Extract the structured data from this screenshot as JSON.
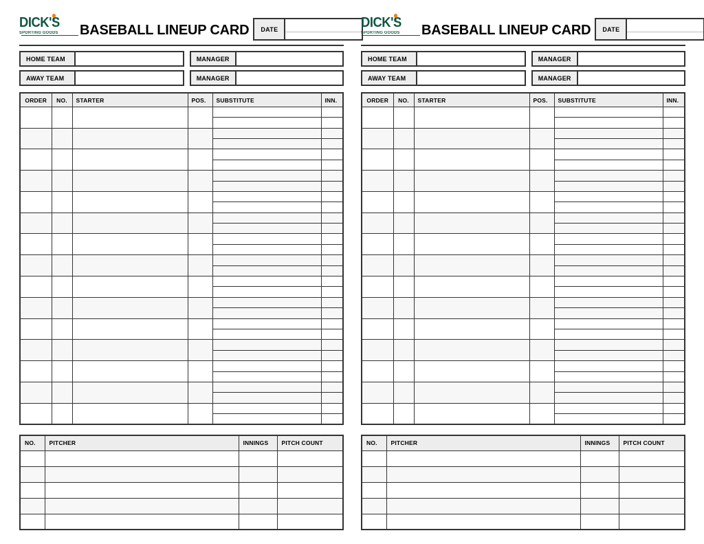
{
  "document": {
    "title": "BASEBALL LINEUP CARD",
    "card_count": 2
  },
  "brand": {
    "name": "DICK'S",
    "tagline": "SPORTING GOODS",
    "green": "#115740",
    "orange": "#F0801E"
  },
  "header": {
    "title": "BASEBALL LINEUP CARD",
    "date_label": "DATE",
    "date_value": ""
  },
  "teams": {
    "home_label": "HOME TEAM",
    "home_value": "",
    "away_label": "AWAY TEAM",
    "away_value": "",
    "manager_label": "MANAGER",
    "home_manager_value": "",
    "away_manager_value": ""
  },
  "lineup": {
    "columns": [
      "ORDER",
      "NO.",
      "STARTER",
      "POS.",
      "SUBSTITUTE",
      "INN."
    ],
    "row_count": 15,
    "substitutes_per_row": 2,
    "rows": [
      {
        "order": "",
        "no": "",
        "starter": "",
        "pos": "",
        "subs": [
          "",
          ""
        ],
        "inn": [
          "",
          ""
        ]
      },
      {
        "order": "",
        "no": "",
        "starter": "",
        "pos": "",
        "subs": [
          "",
          ""
        ],
        "inn": [
          "",
          ""
        ]
      },
      {
        "order": "",
        "no": "",
        "starter": "",
        "pos": "",
        "subs": [
          "",
          ""
        ],
        "inn": [
          "",
          ""
        ]
      },
      {
        "order": "",
        "no": "",
        "starter": "",
        "pos": "",
        "subs": [
          "",
          ""
        ],
        "inn": [
          "",
          ""
        ]
      },
      {
        "order": "",
        "no": "",
        "starter": "",
        "pos": "",
        "subs": [
          "",
          ""
        ],
        "inn": [
          "",
          ""
        ]
      },
      {
        "order": "",
        "no": "",
        "starter": "",
        "pos": "",
        "subs": [
          "",
          ""
        ],
        "inn": [
          "",
          ""
        ]
      },
      {
        "order": "",
        "no": "",
        "starter": "",
        "pos": "",
        "subs": [
          "",
          ""
        ],
        "inn": [
          "",
          ""
        ]
      },
      {
        "order": "",
        "no": "",
        "starter": "",
        "pos": "",
        "subs": [
          "",
          ""
        ],
        "inn": [
          "",
          ""
        ]
      },
      {
        "order": "",
        "no": "",
        "starter": "",
        "pos": "",
        "subs": [
          "",
          ""
        ],
        "inn": [
          "",
          ""
        ]
      },
      {
        "order": "",
        "no": "",
        "starter": "",
        "pos": "",
        "subs": [
          "",
          ""
        ],
        "inn": [
          "",
          ""
        ]
      },
      {
        "order": "",
        "no": "",
        "starter": "",
        "pos": "",
        "subs": [
          "",
          ""
        ],
        "inn": [
          "",
          ""
        ]
      },
      {
        "order": "",
        "no": "",
        "starter": "",
        "pos": "",
        "subs": [
          "",
          ""
        ],
        "inn": [
          "",
          ""
        ]
      },
      {
        "order": "",
        "no": "",
        "starter": "",
        "pos": "",
        "subs": [
          "",
          ""
        ],
        "inn": [
          "",
          ""
        ]
      },
      {
        "order": "",
        "no": "",
        "starter": "",
        "pos": "",
        "subs": [
          "",
          ""
        ],
        "inn": [
          "",
          ""
        ]
      },
      {
        "order": "",
        "no": "",
        "starter": "",
        "pos": "",
        "subs": [
          "",
          ""
        ],
        "inn": [
          "",
          ""
        ]
      }
    ]
  },
  "pitchers": {
    "columns": [
      "NO.",
      "PITCHER",
      "INNINGS",
      "PITCH COUNT"
    ],
    "row_count": 5,
    "rows": [
      {
        "no": "",
        "pitcher": "",
        "innings": "",
        "pitch_count": ""
      },
      {
        "no": "",
        "pitcher": "",
        "innings": "",
        "pitch_count": ""
      },
      {
        "no": "",
        "pitcher": "",
        "innings": "",
        "pitch_count": ""
      },
      {
        "no": "",
        "pitcher": "",
        "innings": "",
        "pitch_count": ""
      },
      {
        "no": "",
        "pitcher": "",
        "innings": "",
        "pitch_count": ""
      }
    ]
  },
  "colors": {
    "header_fill": "#ededed",
    "row_alt_fill": "#f7f7f7",
    "border": "#333333",
    "paper": "#ffffff"
  }
}
